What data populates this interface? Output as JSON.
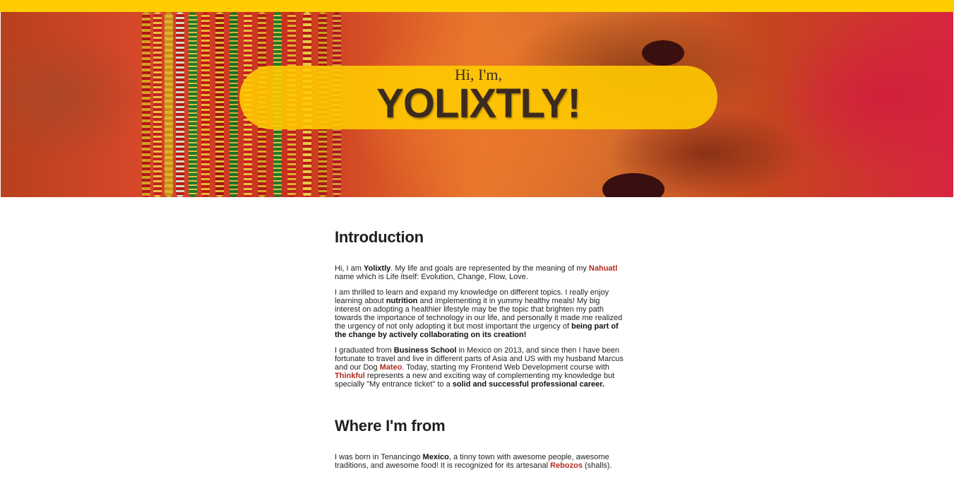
{
  "hero": {
    "greeting": "Hi, I'm,",
    "name": "YOLIXTLY!"
  },
  "colors": {
    "accent": "#ffcc00",
    "link": "#b42a1e"
  },
  "intro": {
    "heading": "Introduction",
    "p1": {
      "a": "Hi, I am ",
      "b_name": "Yolixtly",
      "c": ". My life and goals are represented by the meaning of my ",
      "link": "Nahuatl",
      "d": " name which is Life itself: Evolution, Change, Flow, Love."
    },
    "p2": {
      "a": "I am thrilled to learn and expand my knowledge on different topics. I really enjoy learning about ",
      "b_nutrition": "nutrition",
      "c": " and implementing it in yummy healthy meals! My big interest on adopting a healthier lifestyle may be the topic that brighten my path towards the importance of technology in our life, and personally it made me realized the urgency of not only adopting it but most important the urgency of ",
      "b_change": "being part of the change by actively collaborating on its creation!"
    },
    "p3": {
      "a": "I graduated from ",
      "b_school": "Business School",
      "c": " in Mexico on 2013, and since then I have been fortunate to travel and live in different parts of Asia and US with my husband Marcus and our Dog ",
      "link_mateo": "Mateo",
      "d": ". Today, starting my Frontend Web Development course with ",
      "link_thinkful": "Thinkful",
      "e": " represents a new and exciting way of complementing my knowledge but specially \"My entrance ticket\" to a ",
      "b_career": "solid and successful professional career."
    }
  },
  "from": {
    "heading": "Where I'm from",
    "p1": {
      "a": "I was born in Tenancingo ",
      "b_mexico": "Mexico",
      "c": ", a tinny town with awesome people, awesome traditions, and awesome food! It is recognized for its artesanal ",
      "link_rebozos": "Rebozos",
      "d": " (shalls)."
    }
  }
}
